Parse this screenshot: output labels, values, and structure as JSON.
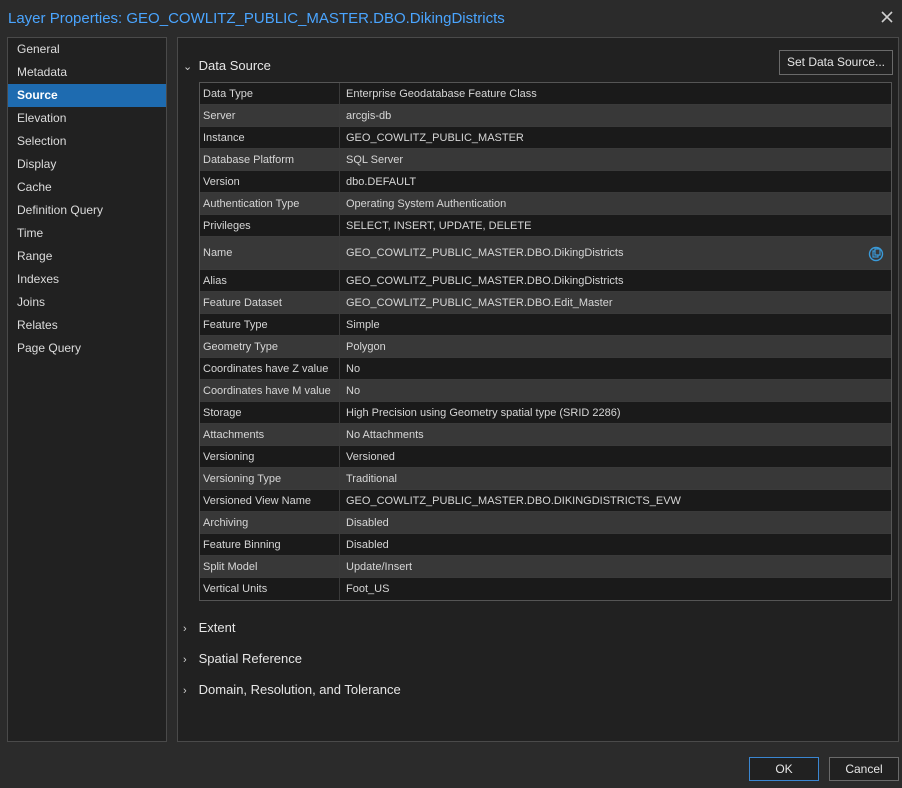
{
  "window": {
    "title": "Layer Properties: GEO_COWLITZ_PUBLIC_MASTER.DBO.DikingDistricts"
  },
  "nav": {
    "items": [
      {
        "label": "General"
      },
      {
        "label": "Metadata"
      },
      {
        "label": "Source",
        "selected": true
      },
      {
        "label": "Elevation"
      },
      {
        "label": "Selection"
      },
      {
        "label": "Display"
      },
      {
        "label": "Cache"
      },
      {
        "label": "Definition Query"
      },
      {
        "label": "Time"
      },
      {
        "label": "Range"
      },
      {
        "label": "Indexes"
      },
      {
        "label": "Joins"
      },
      {
        "label": "Relates"
      },
      {
        "label": "Page Query"
      }
    ]
  },
  "main": {
    "data_source_label": "Data Source",
    "set_source_button": "Set Data Source...",
    "rows": [
      {
        "key": "Data Type",
        "value": "Enterprise Geodatabase Feature Class"
      },
      {
        "key": "Server",
        "value": "arcgis-db"
      },
      {
        "key": "Instance",
        "value": "GEO_COWLITZ_PUBLIC_MASTER"
      },
      {
        "key": "Database Platform",
        "value": "SQL Server"
      },
      {
        "key": "Version",
        "value": "dbo.DEFAULT"
      },
      {
        "key": "Authentication Type",
        "value": "Operating System Authentication"
      },
      {
        "key": "Privileges",
        "value": "SELECT, INSERT, UPDATE, DELETE"
      },
      {
        "key": "Name",
        "value": "GEO_COWLITZ_PUBLIC_MASTER.DBO.DikingDistricts",
        "icon": "copy-to-clipboard-icon"
      },
      {
        "key": "Alias",
        "value": "GEO_COWLITZ_PUBLIC_MASTER.DBO.DikingDistricts"
      },
      {
        "key": "Feature Dataset",
        "value": "GEO_COWLITZ_PUBLIC_MASTER.DBO.Edit_Master"
      },
      {
        "key": "Feature Type",
        "value": "Simple"
      },
      {
        "key": "Geometry Type",
        "value": "Polygon"
      },
      {
        "key": "Coordinates have Z value",
        "value": "No"
      },
      {
        "key": "Coordinates have M value",
        "value": "No"
      },
      {
        "key": "Storage",
        "value": "High Precision using Geometry spatial type (SRID 2286)"
      },
      {
        "key": "Attachments",
        "value": "No Attachments"
      },
      {
        "key": "Versioning",
        "value": "Versioned"
      },
      {
        "key": "Versioning Type",
        "value": "Traditional"
      },
      {
        "key": "Versioned View Name",
        "value": "GEO_COWLITZ_PUBLIC_MASTER.DBO.DIKINGDISTRICTS_EVW"
      },
      {
        "key": "Archiving",
        "value": "Disabled"
      },
      {
        "key": "Feature Binning",
        "value": "Disabled"
      },
      {
        "key": "Split Model",
        "value": "Update/Insert"
      },
      {
        "key": "Vertical Units",
        "value": "Foot_US"
      }
    ],
    "sections": [
      {
        "label": "Extent"
      },
      {
        "label": "Spatial Reference"
      },
      {
        "label": "Domain, Resolution, and Tolerance"
      }
    ]
  },
  "footer": {
    "ok_label": "OK",
    "cancel_label": "Cancel"
  },
  "colors": {
    "accent": "#1e6bb0",
    "title_text": "#4aa5ff",
    "background": "#2b2b2b",
    "panel": "#212121"
  }
}
